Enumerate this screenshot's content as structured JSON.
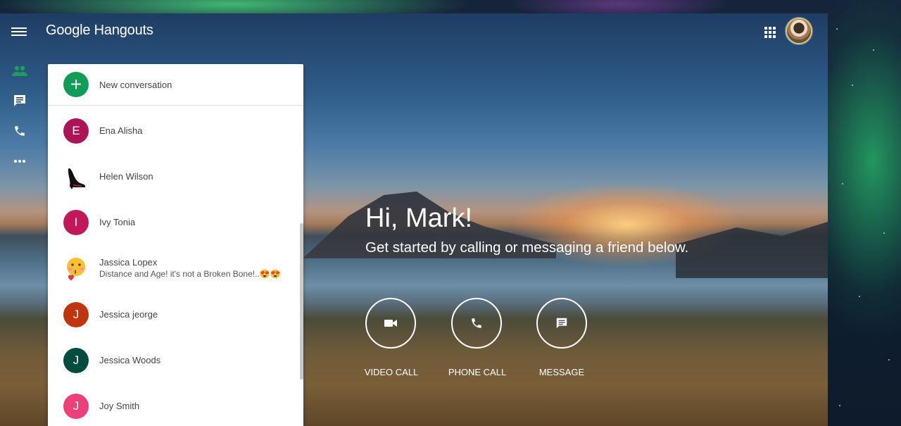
{
  "app": {
    "title": "Google Hangouts"
  },
  "nav": {
    "menu_icon": "hamburger-menu-icon",
    "rail": [
      "contacts-icon",
      "message-icon",
      "phone-icon",
      "more-icon"
    ],
    "apps_icon": "apps-grid-icon"
  },
  "conversations": {
    "new_label": "New conversation",
    "items": [
      {
        "name": "Ena Alisha",
        "initial": "E",
        "color": "#ad1457"
      },
      {
        "name": "Helen Wilson",
        "initial": "",
        "color": "#ffffff"
      },
      {
        "name": "Ivy Tonia",
        "initial": "I",
        "color": "#c2185b"
      },
      {
        "name": "Jassica Lopex",
        "snippet": "Distance and Age! it's not a Broken Bone!..😍😍",
        "initial": "",
        "color": "#ffffff"
      },
      {
        "name": "Jessica jeorge",
        "initial": "J",
        "color": "#bf360c"
      },
      {
        "name": "Jessica Woods",
        "initial": "J",
        "color": "#004d40"
      },
      {
        "name": "Joy Smith",
        "initial": "J",
        "color": "#ec407a"
      }
    ]
  },
  "welcome": {
    "greeting": "Hi, Mark!",
    "subtitle": "Get started by calling or messaging a friend below."
  },
  "actions": [
    {
      "label": "VIDEO CALL",
      "icon": "video-camera-icon"
    },
    {
      "label": "PHONE CALL",
      "icon": "phone-icon"
    },
    {
      "label": "MESSAGE",
      "icon": "message-icon"
    }
  ],
  "colors": {
    "accent_green": "#0f9d58",
    "rail_active": "#0f9d58"
  }
}
